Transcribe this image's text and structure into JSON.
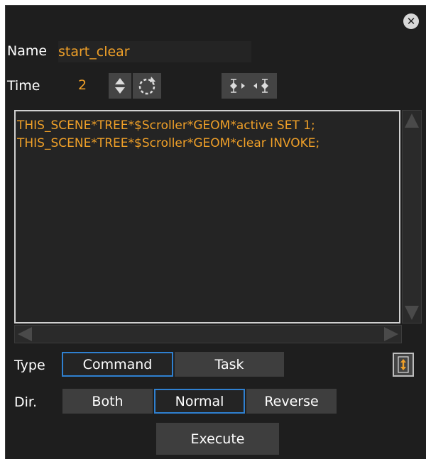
{
  "header": {
    "close_icon": "close-icon"
  },
  "name": {
    "label": "Name",
    "value": "start_clear"
  },
  "time": {
    "label": "Time",
    "value": "2",
    "icons": [
      "up-down-stepper-icon",
      "reset-circle-icon",
      "keyframe-nav-icon"
    ]
  },
  "script": {
    "lines": [
      "THIS_SCENE*TREE*$Scroller*GEOM*active SET 1;",
      "THIS_SCENE*TREE*$Scroller*GEOM*clear INVOKE;"
    ]
  },
  "type": {
    "label": "Type",
    "options": [
      "Command",
      "Task"
    ],
    "selected": "Command"
  },
  "dir": {
    "label": "Dir.",
    "options": [
      "Both",
      "Normal",
      "Reverse"
    ],
    "selected": "Normal"
  },
  "actions": {
    "execute_label": "Execute"
  },
  "colors": {
    "background": "#1e1e1e",
    "accent_text": "#f0a028",
    "selected_border": "#2f80d0",
    "button": "#3e3e3e"
  }
}
